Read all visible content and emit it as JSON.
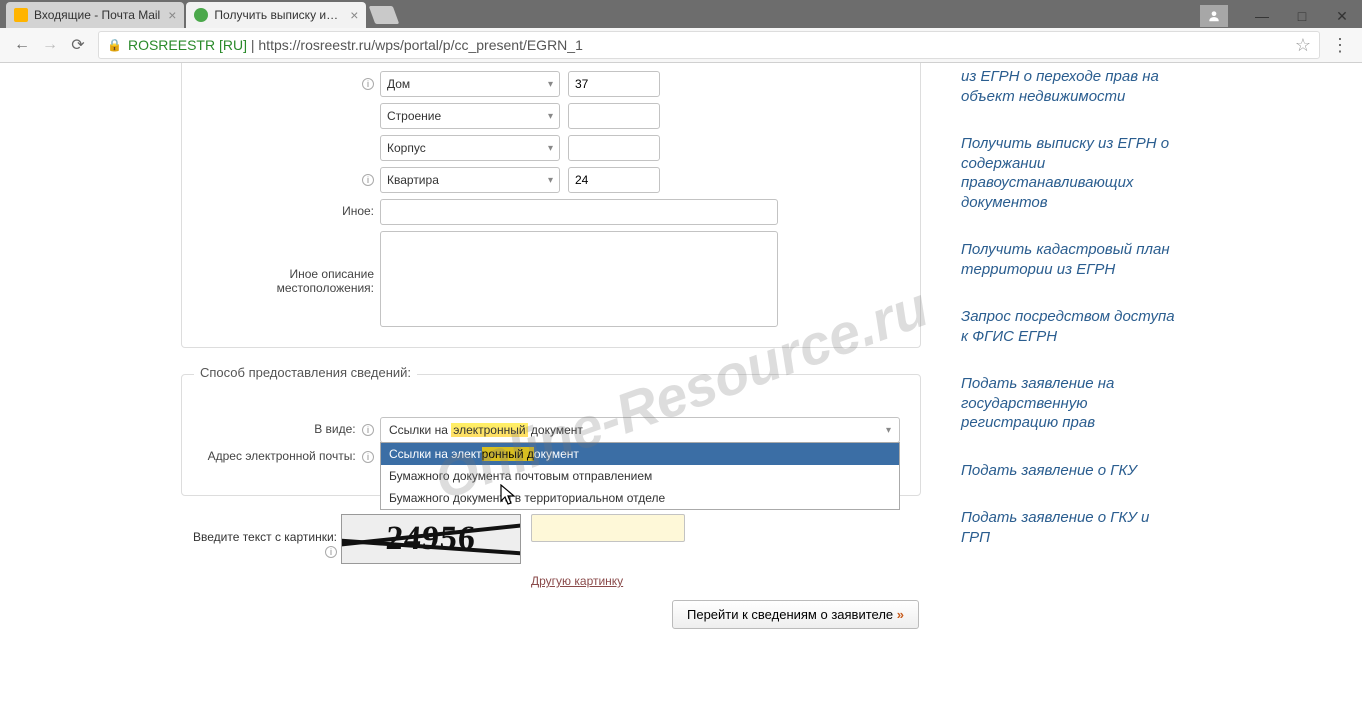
{
  "browser": {
    "tabs": [
      {
        "title": "Входящие - Почта Mail",
        "active": false
      },
      {
        "title": "Получить выписку из ЕГ",
        "active": true
      }
    ],
    "url_host": "ROSREESTR [RU]",
    "url_path": "https://rosreestr.ru/wps/portal/p/cc_present/EGRN_1"
  },
  "form_top": {
    "house_label": "Дом",
    "house_value": "37",
    "building_label": "Строение",
    "building_value": "",
    "korpus_label": "Корпус",
    "korpus_value": "",
    "apt_label": "Квартира",
    "apt_value": "24",
    "other_label": "Иное:",
    "other_value": "",
    "other_desc_label": "Иное описание местоположения:",
    "other_desc_value": ""
  },
  "delivery": {
    "legend": "Способ предоставления сведений:",
    "format_label": "В виде:",
    "format_value": "Ссылки на электронный документ",
    "email_label": "Адрес электронной почты:",
    "options": [
      "Ссылки на электронный документ",
      "Бумажного документа почтовым отправлением",
      "Бумажного документа в территориальном отделе"
    ]
  },
  "captcha": {
    "label": "Введите текст с картинки:",
    "code": "24956",
    "refresh": "Другую картинку"
  },
  "submit_label": "Перейти к сведениям о заявителе",
  "sidebar": {
    "links": [
      "из ЕГРН о переходе прав на объект недвижимости",
      "Получить выписку из ЕГРН о содержании правоустанавливающих документов",
      "Получить кадастровый план территории из ЕГРН",
      "Запрос посредством доступа к ФГИС ЕГРН",
      "Подать заявление на государственную регистрацию прав",
      "Подать заявление о ГКУ",
      "Подать заявление о ГКУ и ГРП"
    ]
  },
  "watermark": "Online-Resource.ru"
}
